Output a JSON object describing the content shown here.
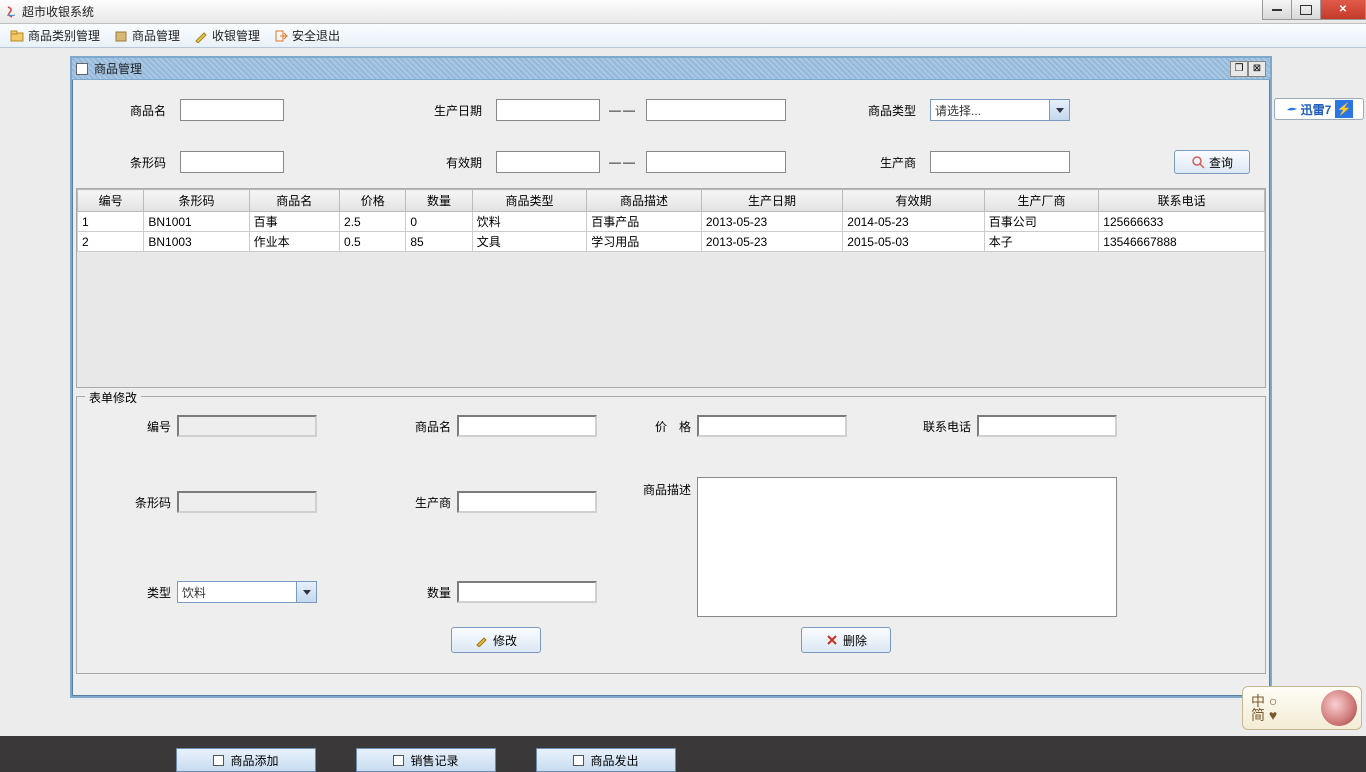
{
  "window": {
    "title": "超市收银系统"
  },
  "menu": {
    "category_mgmt": "商品类别管理",
    "product_mgmt": "商品管理",
    "cashier_mgmt": "收银管理",
    "safe_exit": "安全退出"
  },
  "internal": {
    "title": "商品管理"
  },
  "search": {
    "product_name_label": "商品名",
    "prod_date_label": "生产日期",
    "category_label": "商品类型",
    "category_placeholder": "请选择...",
    "barcode_label": "条形码",
    "expiry_label": "有效期",
    "manufacturer_label": "生产商",
    "dashes": "——",
    "query_button": "查询"
  },
  "table": {
    "headers": {
      "id": "编号",
      "barcode": "条形码",
      "name": "商品名",
      "price": "价格",
      "qty": "数量",
      "category": "商品类型",
      "desc": "商品描述",
      "prod_date": "生产日期",
      "expiry": "有效期",
      "maker": "生产厂商",
      "phone": "联系电话"
    },
    "rows": [
      {
        "id": "1",
        "barcode": "BN1001",
        "name": "百事",
        "price": "2.5",
        "qty": "0",
        "category": "饮料",
        "desc": "百事产品",
        "prod_date": "2013-05-23",
        "expiry": "2014-05-23",
        "maker": "百事公司",
        "phone": "125666633"
      },
      {
        "id": "2",
        "barcode": "BN1003",
        "name": "作业本",
        "price": "0.5",
        "qty": "85",
        "category": "文具",
        "desc": "学习用品",
        "prod_date": "2013-05-23",
        "expiry": "2015-05-03",
        "maker": "本子",
        "phone": "13546667888"
      }
    ]
  },
  "form": {
    "legend": "表单修改",
    "id_label": "编号",
    "name_label": "商品名",
    "price_label": "价　格",
    "phone_label": "联系电话",
    "barcode_label": "条形码",
    "maker_label": "生产商",
    "desc_label": "商品描述",
    "type_label": "类型",
    "type_value": "饮料",
    "qty_label": "数量",
    "modify_button": "修改",
    "delete_button": "删除"
  },
  "bottom": {
    "add_product": "商品添加",
    "sales_record": "销售记录",
    "product_out": "商品发出"
  },
  "widgets": {
    "xunlei": "迅雷7",
    "ime_line1": "中 ○",
    "ime_line2": "简 ♥"
  }
}
